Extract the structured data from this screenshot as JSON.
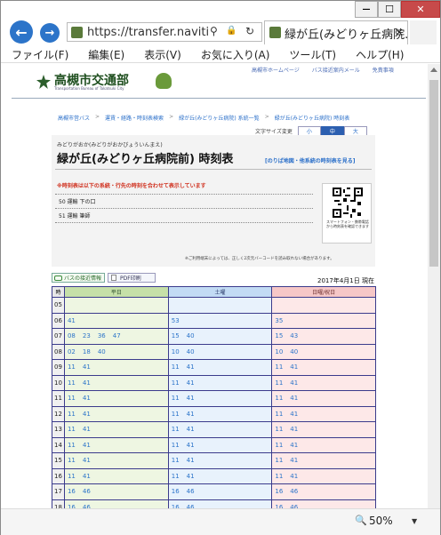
{
  "browser": {
    "url": "https://transfer.naviti",
    "tab_title": "緑が丘(みどりヶ丘病院...",
    "zoom": "50%",
    "back_glyph": "←",
    "fwd_glyph": "→",
    "search_glyph": "⚲",
    "lock_glyph": "🔒",
    "refresh_glyph": "↻",
    "close_tab_glyph": "×",
    "min_glyph": "—",
    "max_glyph": "☐",
    "close_glyph": "✕",
    "zoom_glyph": "🔍",
    "zoom_drop": "▼"
  },
  "menu": [
    "ファイル(F)",
    "編集(E)",
    "表示(V)",
    "お気に入り(A)",
    "ツール(T)",
    "ヘルプ(H)"
  ],
  "site": {
    "logo_title": "高槻市交通部",
    "logo_sub": "Transportation Bureau of Takatsuki City",
    "top_links": [
      "高槻市ホームページ",
      "バス接近案内メール",
      "免責事項"
    ]
  },
  "breadcrumb": [
    "高槻市営バス",
    "運賃・経路・時刻表検索",
    "緑が丘(みどりヶ丘病院) 系統一覧",
    "緑が丘(みどりヶ丘病院) 時刻表"
  ],
  "font_size": {
    "label": "文字サイズ変更",
    "small": "小",
    "medium": "中",
    "large": "大"
  },
  "stop": {
    "kana": "みどりがおか(みどりがおかびょういんまえ)",
    "name": "緑が丘(みどりヶ丘病院前) 時刻表",
    "map_link": "[のりば地図・他系統の時刻表を見る]"
  },
  "notice": "※時刻表は以下の系統・行先の時刻を合わせて表示しています",
  "routes": [
    "50 運輸 下の口",
    "51 運輸 筆師"
  ],
  "qr_caption": "スマートフォン・携帯電話から時刻表を確認できます",
  "qr_note": "※ご利用端末によっては、正しく2次元バーコードを読み取れない場合があります。",
  "buttons": {
    "approach": "バスの接近情報",
    "pdf": "PDF印刷"
  },
  "date": "2017年4月1日 現在",
  "headers": {
    "hour": "時",
    "weekday": "平日",
    "saturday": "土曜",
    "holiday": "日曜/祝日"
  },
  "rows": [
    {
      "h": "05",
      "wd": [],
      "sa": [],
      "su": []
    },
    {
      "h": "06",
      "wd": [
        "41"
      ],
      "sa": [
        "53"
      ],
      "su": [
        "35"
      ]
    },
    {
      "h": "07",
      "wd": [
        "08",
        "23",
        "36",
        "47"
      ],
      "sa": [
        "15",
        "40"
      ],
      "su": [
        "15",
        "43"
      ]
    },
    {
      "h": "08",
      "wd": [
        "02",
        "18",
        "40"
      ],
      "sa": [
        "10",
        "40"
      ],
      "su": [
        "10",
        "40"
      ]
    },
    {
      "h": "09",
      "wd": [
        "11",
        "41"
      ],
      "sa": [
        "11",
        "41"
      ],
      "su": [
        "11",
        "41"
      ]
    },
    {
      "h": "10",
      "wd": [
        "11",
        "41"
      ],
      "sa": [
        "11",
        "41"
      ],
      "su": [
        "11",
        "41"
      ]
    },
    {
      "h": "11",
      "wd": [
        "11",
        "41"
      ],
      "sa": [
        "11",
        "41"
      ],
      "su": [
        "11",
        "41"
      ]
    },
    {
      "h": "12",
      "wd": [
        "11",
        "41"
      ],
      "sa": [
        "11",
        "41"
      ],
      "su": [
        "11",
        "41"
      ]
    },
    {
      "h": "13",
      "wd": [
        "11",
        "41"
      ],
      "sa": [
        "11",
        "41"
      ],
      "su": [
        "11",
        "41"
      ]
    },
    {
      "h": "14",
      "wd": [
        "11",
        "41"
      ],
      "sa": [
        "11",
        "41"
      ],
      "su": [
        "11",
        "41"
      ]
    },
    {
      "h": "15",
      "wd": [
        "11",
        "41"
      ],
      "sa": [
        "11",
        "41"
      ],
      "su": [
        "11",
        "41"
      ]
    },
    {
      "h": "16",
      "wd": [
        "11",
        "41"
      ],
      "sa": [
        "11",
        "41"
      ],
      "su": [
        "11",
        "41"
      ]
    },
    {
      "h": "17",
      "wd": [
        "16",
        "46"
      ],
      "sa": [
        "16",
        "46"
      ],
      "su": [
        "16",
        "46"
      ]
    },
    {
      "h": "18",
      "wd": [
        "16",
        "46"
      ],
      "sa": [
        "16",
        "46"
      ],
      "su": [
        "16",
        "46"
      ]
    }
  ],
  "colors": {
    "weekday": "#eef6e2",
    "weekday_head": "#c6e0a8",
    "saturday": "#e8f2fc",
    "saturday_head": "#c2dbf4",
    "holiday": "#fde8e8",
    "holiday_head": "#f6c7c7",
    "border": "#3b3b8c",
    "accent": "#2c74c9"
  }
}
